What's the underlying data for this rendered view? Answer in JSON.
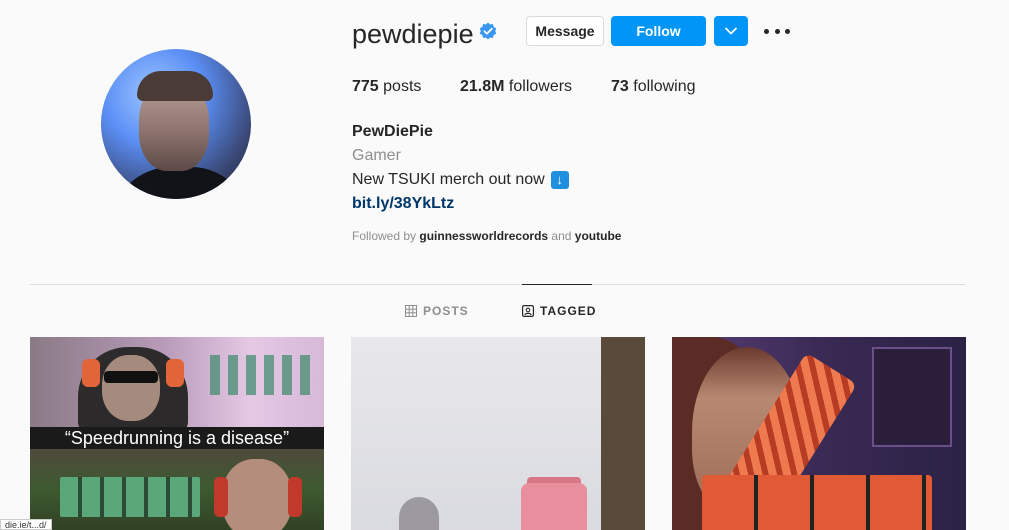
{
  "profile": {
    "username": "pewdiepie",
    "verified_icon": "verified-badge-icon",
    "full_name": "PewDiePie",
    "category": "Gamer",
    "bio_text": "New TSUKI merch out now",
    "bio_emoji": "↓",
    "link": "bit.ly/38YkLtz",
    "followed_by_prefix": "Followed by",
    "followed_by_1": "guinnessworldrecords",
    "followed_by_and": "and",
    "followed_by_2": "youtube"
  },
  "buttons": {
    "message": "Message",
    "follow": "Follow"
  },
  "stats": {
    "posts_count": "775",
    "posts_label": "posts",
    "followers_count": "21.8M",
    "followers_label": "followers",
    "following_count": "73",
    "following_label": "following"
  },
  "tabs": {
    "posts": "POSTS",
    "tagged": "TAGGED",
    "active": "tagged"
  },
  "tiles": {
    "tile1_caption": "“Speedrunning is a disease”"
  },
  "status_bar": {
    "url": "die.ie/t...d/"
  },
  "colors": {
    "accent": "#0095f6",
    "link": "#00376b",
    "muted": "#8e8e8e",
    "text": "#262626"
  }
}
